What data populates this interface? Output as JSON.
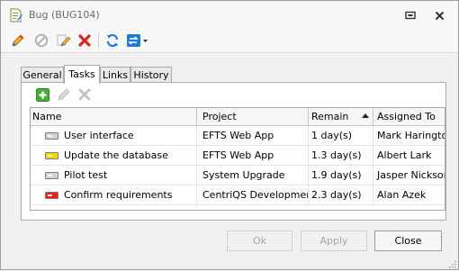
{
  "window": {
    "title": "Bug (BUG104)",
    "icons": {
      "app": "document-edit-icon",
      "restore": "restore-icon",
      "close": "close-icon"
    }
  },
  "toolbar": {
    "items": [
      {
        "name": "edit-icon",
        "color": "#2f6fcf"
      },
      {
        "name": "cancel-icon",
        "color": "#b0b0b0"
      },
      {
        "name": "edit-pencil-icon",
        "color": "#2f6fcf"
      },
      {
        "name": "delete-icon",
        "color": "#d8261f"
      },
      {
        "name": "refresh-icon",
        "color": "#1f7ad6"
      },
      {
        "name": "change-status-icon",
        "color": "#1f7ad6"
      }
    ]
  },
  "tabs": [
    {
      "label": "General",
      "active": false
    },
    {
      "label": "Tasks",
      "active": true
    },
    {
      "label": "Links",
      "active": false
    },
    {
      "label": "History",
      "active": false
    }
  ],
  "panel_toolbar": {
    "items": [
      {
        "name": "add-task-icon",
        "color": "#3ea431"
      },
      {
        "name": "edit-task-icon",
        "color": "#bdbdbd"
      },
      {
        "name": "delete-task-icon",
        "color": "#bdbdbd"
      }
    ]
  },
  "grid": {
    "columns": [
      {
        "label": "Name"
      },
      {
        "label": "Project"
      },
      {
        "label": "Remain",
        "sorted": "ascending"
      },
      {
        "label": "Assigned To"
      }
    ],
    "rows": [
      {
        "priority": "low",
        "priority_color": "#d4d4d4",
        "name": "User interface",
        "project": "EFTS Web App",
        "remain": "1 day(s)",
        "assigned_to": "Mark Harington"
      },
      {
        "priority": "normal",
        "priority_color": "#f5d500",
        "name": "Update the database",
        "project": "EFTS Web App",
        "remain": "1.3 day(s)",
        "assigned_to": "Albert Lark"
      },
      {
        "priority": "low",
        "priority_color": "#d4d4d4",
        "name": "Pilot test",
        "project": "System Upgrade",
        "remain": "1.9 day(s)",
        "assigned_to": "Jasper Nickson"
      },
      {
        "priority": "high",
        "priority_color": "#e8221b",
        "name": "Confirm requirements",
        "project": "CentriQS Development",
        "remain": "2.3 day(s)",
        "assigned_to": "Alan Azek"
      }
    ]
  },
  "buttons": {
    "ok": {
      "label": "Ok",
      "enabled": false
    },
    "apply": {
      "label": "Apply",
      "enabled": false
    },
    "close": {
      "label": "Close",
      "enabled": true
    }
  }
}
